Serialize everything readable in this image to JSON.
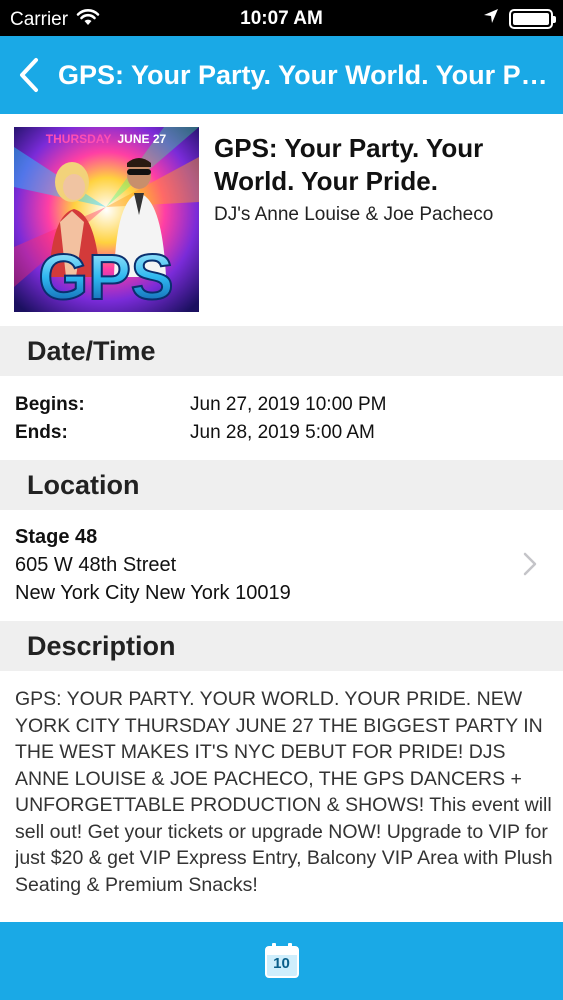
{
  "status_bar": {
    "carrier": "Carrier",
    "time": "10:07 AM"
  },
  "nav": {
    "title": "GPS: Your Party. Your World. Your Pride."
  },
  "event": {
    "image_caption": "THURSDAY JUNE 27",
    "image_caption_day": "THURSDAY",
    "image_caption_date": "JUNE 27",
    "image_logo": "GPS",
    "title": "GPS: Your Party. Your World. Your Pride.",
    "subtitle": "DJ's Anne Louise & Joe Pacheco"
  },
  "date_time": {
    "header": "Date/Time",
    "begins_label": "Begins:",
    "begins_value": "Jun 27, 2019 10:00 PM",
    "ends_label": "Ends:",
    "ends_value": "Jun 28, 2019 5:00 AM"
  },
  "location": {
    "header": "Location",
    "venue": "Stage 48",
    "street": "605 W 48th Street",
    "city": "New York City New York 10019"
  },
  "description": {
    "header": "Description",
    "text": "GPS: YOUR PARTY. YOUR WORLD. YOUR PRIDE. NEW YORK CITY THURSDAY JUNE 27 THE BIGGEST PARTY IN THE WEST MAKES IT'S NYC DEBUT FOR PRIDE! DJS ANNE LOUISE & JOE PACHECO, THE GPS DANCERS + UNFORGETTABLE PRODUCTION & SHOWS! This event will sell out! Get your tickets or upgrade NOW! Upgrade to VIP for just $20 & get VIP Express Entry, Balcony VIP Area with Plush Seating & Premium Snacks!"
  },
  "tab_bar": {
    "calendar_day": "10"
  },
  "colors": {
    "accent": "#1aa9e6",
    "section_bg": "#efefef"
  }
}
